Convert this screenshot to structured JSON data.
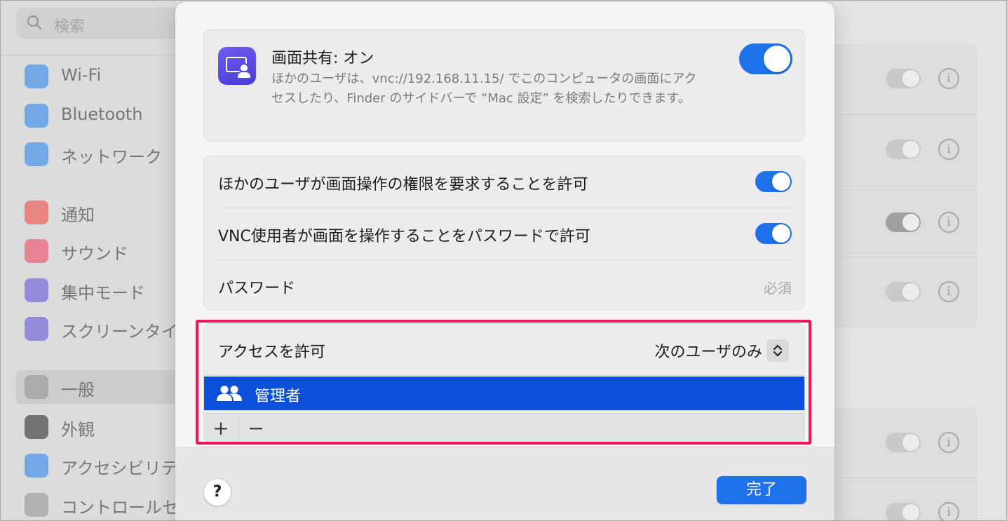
{
  "sidebar": {
    "search_placeholder": "検索",
    "items": [
      {
        "label": "Wi-Fi",
        "icon": "wifi-icon",
        "color": "#1e7ef0"
      },
      {
        "label": "Bluetooth",
        "icon": "bluetooth-icon",
        "color": "#1e7ef0"
      },
      {
        "label": "ネットワーク",
        "icon": "globe-icon",
        "color": "#1e7ef0"
      },
      {
        "label": "通知",
        "icon": "bell-icon",
        "color": "#f03a3a"
      },
      {
        "label": "サウンド",
        "icon": "speaker-icon",
        "color": "#f03a5a"
      },
      {
        "label": "集中モード",
        "icon": "moon-icon",
        "color": "#5a4ad8"
      },
      {
        "label": "スクリーンタイ",
        "icon": "hourglass-icon",
        "color": "#5a4ad8"
      },
      {
        "label": "一般",
        "icon": "gear-icon",
        "color": "#8e8e93"
      },
      {
        "label": "外観",
        "icon": "appearance-icon",
        "color": "#1d1d1f"
      },
      {
        "label": "アクセシビリテ",
        "icon": "accessibility-icon",
        "color": "#1e7ef0"
      },
      {
        "label": "コントロールセ",
        "icon": "control-center-icon",
        "color": "#8e8e93"
      }
    ]
  },
  "background": {
    "info_glyph": "i"
  },
  "sheet": {
    "screen_sharing": {
      "title": "画面共有: オン",
      "description": "ほかのユーザは、vnc://192.168.11.15/ でこのコンピュータの画面にアクセスしたり、Finder のサイドバーで “Mac 設定” を検索したりできます。",
      "enabled": true
    },
    "options": {
      "allow_request_control": "ほかのユーザが画面操作の権限を要求することを許可",
      "vnc_password_control": "VNC使用者が画面を操作することをパスワードで許可",
      "password_label": "パスワード",
      "password_value": "必須"
    },
    "access": {
      "label": "アクセスを許可",
      "popup_value": "次のユーザのみ",
      "users": [
        "管理者"
      ],
      "add_glyph": "+",
      "remove_glyph": "−"
    },
    "footer": {
      "help_glyph": "?",
      "done_label": "完了"
    }
  },
  "colors": {
    "accent": "#1e71e8",
    "selection": "#0a4fd8",
    "highlight": "#f0145f"
  }
}
